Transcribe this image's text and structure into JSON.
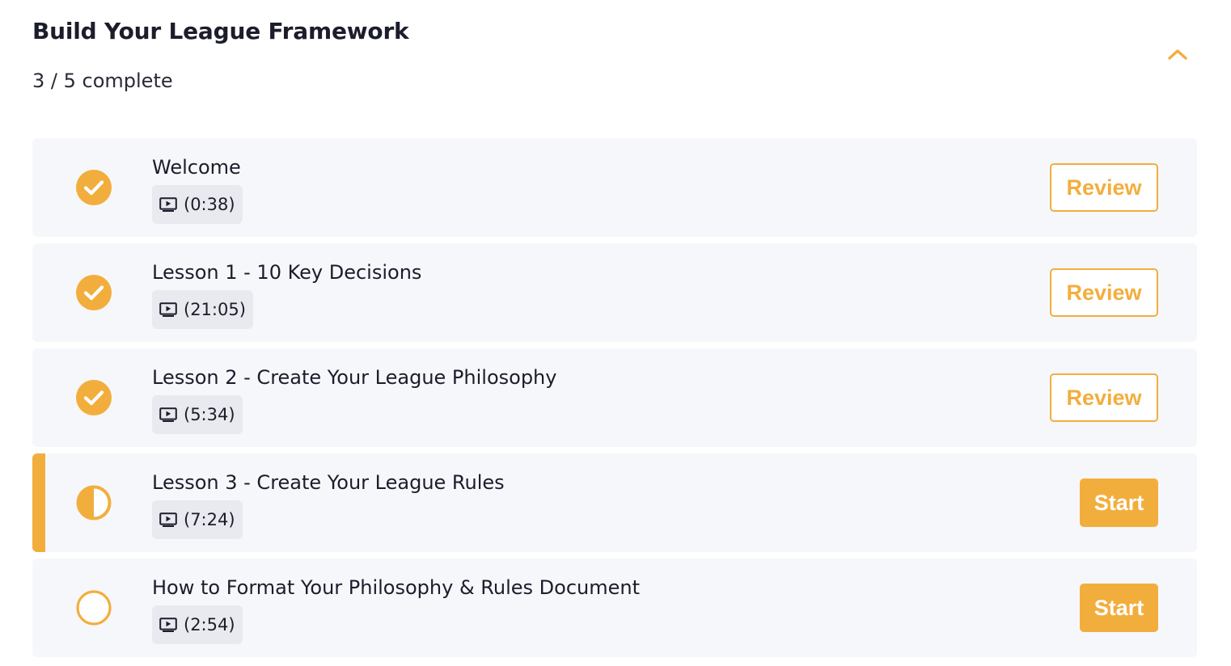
{
  "section": {
    "title": "Build Your League Framework",
    "progress": "3 / 5 complete",
    "collapse_icon": "chevron-up-icon"
  },
  "colors": {
    "accent": "#f2ae3d",
    "row_background": "#f6f7fb",
    "chip_background": "#e9eaef",
    "text": "#1c1d2b"
  },
  "lessons": [
    {
      "title": "Welcome",
      "duration": "(0:38)",
      "status": "complete",
      "status_icon": "check-circle-icon",
      "action": "Review"
    },
    {
      "title": "Lesson 1 - 10 Key Decisions",
      "duration": "(21:05)",
      "status": "complete",
      "status_icon": "check-circle-icon",
      "action": "Review"
    },
    {
      "title": "Lesson 2 - Create Your League Philosophy",
      "duration": "(5:34)",
      "status": "complete",
      "status_icon": "check-circle-icon",
      "action": "Review"
    },
    {
      "title": "Lesson 3 - Create Your League Rules",
      "duration": "(7:24)",
      "status": "in-progress",
      "status_icon": "half-circle-icon",
      "action": "Start"
    },
    {
      "title": "How to Format Your Philosophy & Rules Document",
      "duration": "(2:54)",
      "status": "not-started",
      "status_icon": "empty-circle-icon",
      "action": "Start"
    }
  ]
}
